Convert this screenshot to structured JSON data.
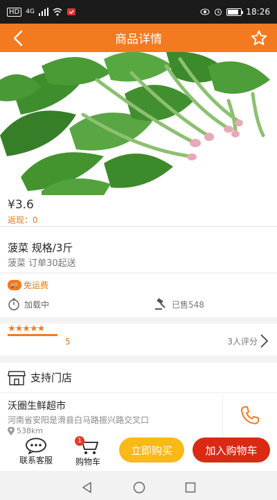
{
  "status_bar": {
    "network": "HD",
    "signal": "4G",
    "time": "18:26",
    "battery_level": 0.82
  },
  "header": {
    "title": "商品详情",
    "back_icon": "chevron-left-icon",
    "favorite_icon": "star-outline-icon",
    "background": "#f47a1f"
  },
  "product": {
    "image_subject": "spinach",
    "price": "¥3.6",
    "rebate": "返现：0",
    "name": "菠菜 规格/3斤",
    "subtitle": "菠菜 订单30起送",
    "free_shipping": "免运费",
    "loading_text": "加载中",
    "sold_text": "已售548"
  },
  "rating": {
    "stars": "★★★★★",
    "star_count": 5,
    "score": "5",
    "reviews_text": "3人评分"
  },
  "store": {
    "section_title": "支持门店",
    "name": "沃圈生鲜超市",
    "address": "河南省安阳是滑县白马路振兴路交叉口",
    "distance": "538km"
  },
  "bottom_bar": {
    "service_label": "联系客服",
    "cart_label": "购物车",
    "cart_count": "1",
    "buy_now": "立即购买",
    "add_to_cart": "加入购物车"
  },
  "colors": {
    "accent": "#f47a1f",
    "buy_now": "#f9b916",
    "add_to_cart": "#d92a14"
  }
}
